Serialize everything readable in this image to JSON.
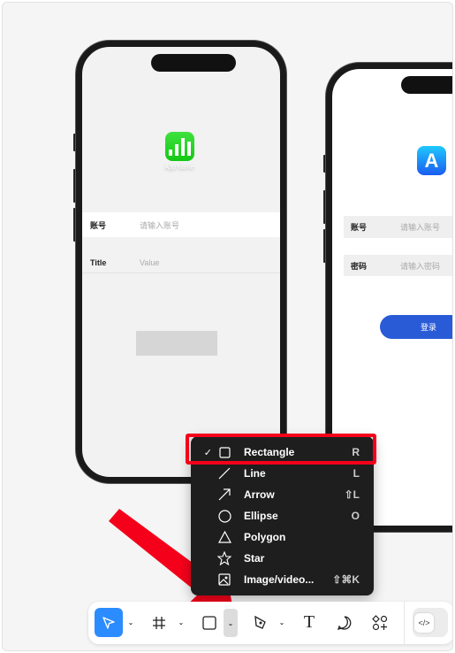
{
  "phone1": {
    "app_name": "App Name",
    "app_icon": "numbers-chart-icon",
    "rows": [
      {
        "label": "账号",
        "placeholder": "请输入账号"
      },
      {
        "label": "Title",
        "placeholder": "Value"
      }
    ]
  },
  "phone2": {
    "app_icon": "app-store-icon",
    "rows": [
      {
        "label": "账号",
        "placeholder": "请输入账号"
      },
      {
        "label": "密码",
        "placeholder": "请输入密码"
      }
    ],
    "login_button": "登录"
  },
  "shape_menu": {
    "items": [
      {
        "label": "Rectangle",
        "shortcut": "R",
        "icon": "rectangle-icon",
        "checked": true
      },
      {
        "label": "Line",
        "shortcut": "L",
        "icon": "line-icon"
      },
      {
        "label": "Arrow",
        "shortcut": "⇧L",
        "icon": "arrow-icon"
      },
      {
        "label": "Ellipse",
        "shortcut": "O",
        "icon": "ellipse-icon"
      },
      {
        "label": "Polygon",
        "shortcut": "",
        "icon": "polygon-icon"
      },
      {
        "label": "Star",
        "shortcut": "",
        "icon": "star-icon"
      },
      {
        "label": "Image/video...",
        "shortcut": "⇧⌘K",
        "icon": "image-icon"
      }
    ],
    "check": "✓"
  },
  "toolbar": {
    "tools": [
      "move-tool",
      "frame-tool",
      "rectangle-tool",
      "pen-tool",
      "text-tool",
      "comment-tool",
      "components-tool",
      "dev-mode-toggle"
    ],
    "text_glyph": "T",
    "accent": "#2b8cff"
  },
  "colors": {
    "highlight": "#f5001a",
    "login": "#2a5bd7"
  }
}
